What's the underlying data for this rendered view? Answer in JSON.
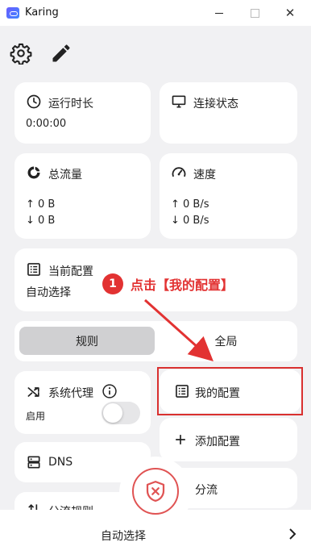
{
  "window": {
    "title": "Karing",
    "close_glyph": "✕"
  },
  "toolbar": {
    "settings_icon": "gear-icon",
    "edit_icon": "pencil-icon"
  },
  "cards": {
    "runtime": {
      "title": "运行时长",
      "value": "0:00:00",
      "icon": "clock-icon"
    },
    "connection": {
      "title": "连接状态",
      "icon": "monitor-icon"
    },
    "traffic": {
      "title": "总流量",
      "up": "↑ 0 B",
      "down": "↓ 0 B",
      "icon": "traffic-icon"
    },
    "speed": {
      "title": "速度",
      "up": "↑ 0 B/s",
      "down": "↓ 0 B/s",
      "icon": "speedometer-icon"
    },
    "current_profile": {
      "title": "当前配置",
      "value": "自动选择",
      "icon": "list-icon"
    }
  },
  "mode": {
    "rule": "规则",
    "global": "全局",
    "selected": "规则"
  },
  "system_proxy": {
    "title": "系统代理",
    "enable_label": "启用",
    "enabled": false
  },
  "menu": {
    "my_profiles": "我的配置",
    "add_profile": "添加配置",
    "dns": "DNS",
    "split": "分流",
    "split_rules": "分流规则"
  },
  "bottom": {
    "selected_server": "自动选择"
  },
  "annotation": {
    "number": "1",
    "text": "点击【我的配置】"
  },
  "colors": {
    "accent_red": "#e23232",
    "background": "#f1f1f3",
    "card": "#ffffff"
  }
}
